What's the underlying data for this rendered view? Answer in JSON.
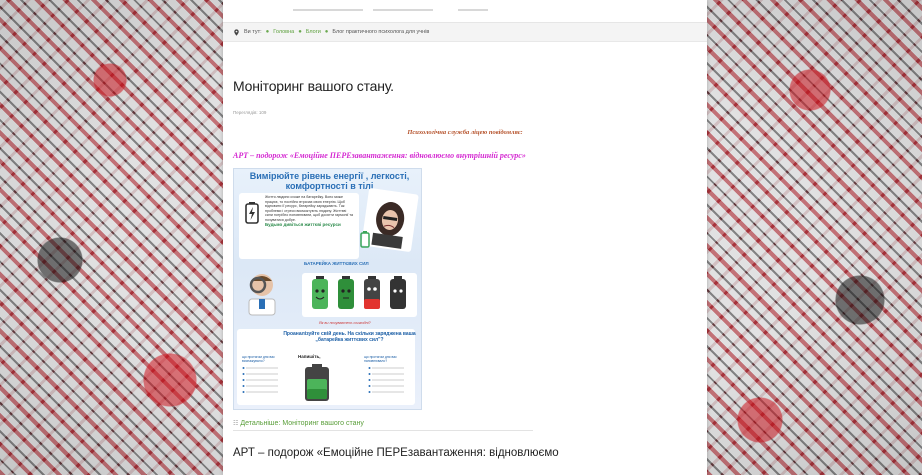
{
  "breadcrumb": {
    "prefix": "Ви тут:",
    "items": [
      "Головна",
      "Блоги",
      "Блог практичного психолога для учнів"
    ]
  },
  "article": {
    "title": "Моніторинг вашого стану.",
    "views": "Переглядів: 109",
    "notice": "Психологічна служба ліцею повідомляє:",
    "event": "АРТ – подорож «Емоційне ПЕРЕзавантаження: відновлюємо внутрішній ресурс»",
    "details_link": "Детальніше: Моніторинг вашого стану"
  },
  "poster": {
    "title": "Вимірюйте рівень енергії , легкості, комфортності в тілі",
    "card_text": "Життя людини схоже на батарейку. Воно може працює, то постійно втрачає свою енергію. Щоб відновити її ресурс, батарейку заряджають. Так проблеми і стреси висмоктують людину. Життєві сили потрібно поповнювати, щоб досягти гармонії та почуватися добре.",
    "card_highlight": "Будьмо дивіться життєві ресурси",
    "batteries_label": "БАТАРЕЙКА ЖИТТЄВИХ СИЛ",
    "question": "Як ви почуваєтесь сьогодні?",
    "analyse": "Проаналізуйте свій день. На скільки заряджена ваша „батарейка життєвих сил\"?",
    "col_left": "що протягом дня вас виснажувало?",
    "col_mid": "Напишіть,",
    "col_right": "що протягом дня вас наповнювало?"
  },
  "next_article": {
    "title": "АРТ – подорож «Емоційне ПЕРЕзавантаження: відновлюємо"
  },
  "colors": {
    "link_green": "#5a9e3a",
    "notice_brown": "#b5522b",
    "event_magenta": "#d52bd2",
    "poster_blue": "#2a6fb6"
  }
}
